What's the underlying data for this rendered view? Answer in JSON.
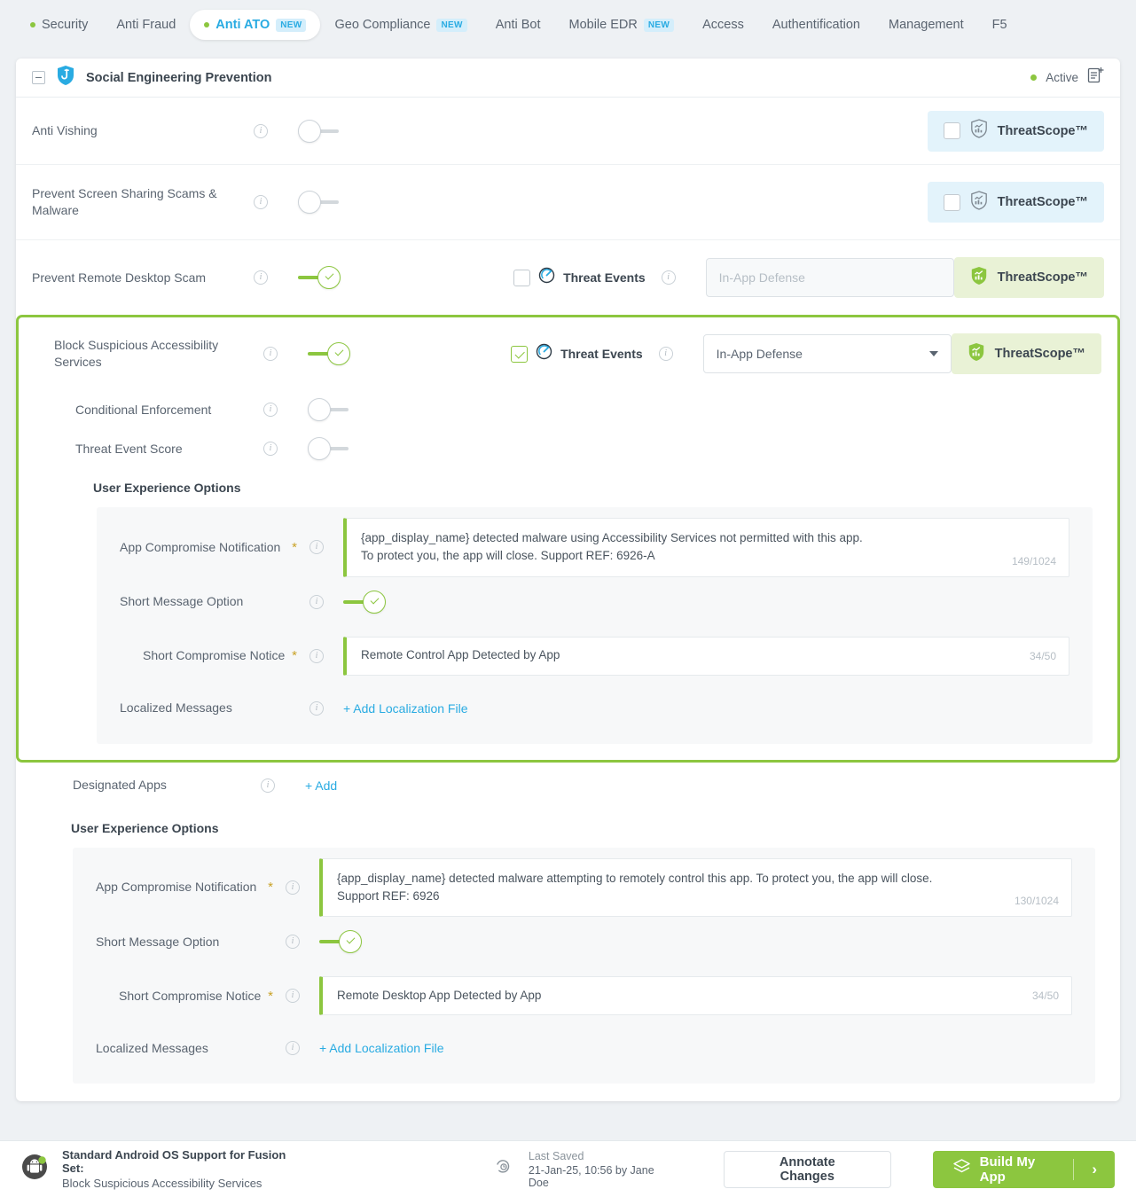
{
  "tabs": [
    {
      "label": "Security",
      "dot": true,
      "badge": null,
      "active": false
    },
    {
      "label": "Anti Fraud",
      "dot": false,
      "badge": null,
      "active": false
    },
    {
      "label": "Anti ATO",
      "dot": true,
      "badge": "NEW",
      "active": true
    },
    {
      "label": "Geo Compliance",
      "dot": false,
      "badge": "NEW",
      "active": false
    },
    {
      "label": "Anti Bot",
      "dot": false,
      "badge": null,
      "active": false
    },
    {
      "label": "Mobile EDR",
      "dot": false,
      "badge": "NEW",
      "active": false
    },
    {
      "label": "Access",
      "dot": false,
      "badge": null,
      "active": false
    },
    {
      "label": "Authentification",
      "dot": false,
      "badge": null,
      "active": false
    },
    {
      "label": "Management",
      "dot": false,
      "badge": null,
      "active": false
    },
    {
      "label": "F5",
      "dot": false,
      "badge": null,
      "active": false
    }
  ],
  "card": {
    "title": "Social Engineering Prevention",
    "status": "Active",
    "icon": "phishing-shield-icon",
    "note_icon": "add-note-icon"
  },
  "threatscope_label": "ThreatScope™",
  "threat_events_label": "Threat Events",
  "rows": {
    "anti_vishing": {
      "label": "Anti Vishing",
      "toggle": "off",
      "threatscope_checked": false,
      "threatscope_state": "inactive"
    },
    "screen_sharing": {
      "label": "Prevent Screen Sharing Scams & Malware",
      "toggle": "off",
      "threatscope_checked": false,
      "threatscope_state": "inactive"
    },
    "remote_desktop": {
      "label": "Prevent Remote Desktop Scam",
      "toggle": "on",
      "threat_events_checked": false,
      "select_value": "In-App Defense",
      "select_disabled": true,
      "threatscope_state": "active"
    },
    "block_accessibility": {
      "label": "Block Suspicious Accessibility Services",
      "toggle": "on",
      "threat_events_checked": true,
      "select_value": "In-App Defense",
      "select_disabled": false,
      "threatscope_state": "active"
    },
    "conditional_enforcement": {
      "label": "Conditional Enforcement",
      "toggle": "off"
    },
    "threat_event_score": {
      "label": "Threat Event Score",
      "toggle": "off"
    },
    "designated_apps": {
      "label": "Designated Apps",
      "add_label": "+ Add"
    }
  },
  "ux_inner": {
    "section_title": "User Experience Options",
    "app_compromise_label": "App Compromise Notification",
    "app_compromise_value": "{app_display_name} detected malware using Accessibility Services not permitted with this app.\nTo protect you, the app will close. Support REF: 6926-A",
    "app_compromise_counter": "149/1024",
    "short_message_label": "Short Message Option",
    "short_message_toggle": "on",
    "short_notice_label": "Short Compromise Notice",
    "short_notice_value": "Remote Control App Detected by App",
    "short_notice_counter": "34/50",
    "localized_label": "Localized Messages",
    "localized_link": "+ Add Localization File"
  },
  "ux_outer": {
    "section_title": "User Experience Options",
    "app_compromise_label": "App Compromise Notification",
    "app_compromise_value": "{app_display_name} detected malware attempting to remotely control this app. To protect you, the app will close.\nSupport REF: 6926",
    "app_compromise_counter": "130/1024",
    "short_message_label": "Short Message Option",
    "short_message_toggle": "on",
    "short_notice_label": "Short Compromise Notice",
    "short_notice_value": "Remote Desktop App Detected by App",
    "short_notice_counter": "34/50",
    "localized_label": "Localized Messages",
    "localized_link": "+ Add Localization File"
  },
  "footer": {
    "os_line1": "Standard Android OS Support for Fusion Set:",
    "os_line2": "Block Suspicious Accessibility Services",
    "saved_label": "Last Saved",
    "saved_value": "21-Jan-25, 10:56 by Jane Doe",
    "annotate_label": "Annotate Changes",
    "build_label": "Build My App",
    "build_arrow": "›"
  },
  "colors": {
    "accent_green": "#8cc63f",
    "accent_blue": "#29abe2",
    "text_dark": "#3c4650",
    "text_muted": "#5a6470"
  }
}
